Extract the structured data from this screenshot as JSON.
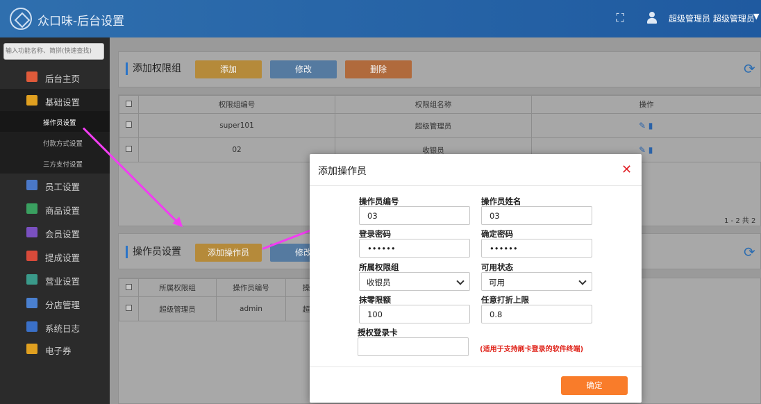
{
  "app": {
    "title": "众口味-后台设置",
    "username": "超级管理员 超级管理员"
  },
  "sidebar": {
    "search_placeholder": "输入功能名称、简拼(快速查找)",
    "items": [
      {
        "label": "后台主页",
        "color": "#e05a3a"
      },
      {
        "label": "基础设置",
        "color": "#e0a020"
      },
      {
        "label": "员工设置",
        "color": "#4a78c8"
      },
      {
        "label": "商品设置",
        "color": "#3aa060"
      },
      {
        "label": "会员设置",
        "color": "#7a50c0"
      },
      {
        "label": "提成设置",
        "color": "#d84a3a"
      },
      {
        "label": "营业设置",
        "color": "#3a9a8a"
      },
      {
        "label": "分店管理",
        "color": "#4a80d0"
      },
      {
        "label": "系统日志",
        "color": "#3a70c8"
      },
      {
        "label": "电子券",
        "color": "#e0a020"
      }
    ],
    "subitems": [
      "操作员设置",
      "付款方式设置",
      "三方支付设置"
    ]
  },
  "group_panel": {
    "title": "添加权限组",
    "buttons": [
      "添加",
      "修改",
      "删除"
    ],
    "columns": [
      "权限组编号",
      "权限组名称",
      "操作"
    ],
    "rows": [
      [
        "super101",
        "超级管理员"
      ],
      [
        "02",
        "收银员"
      ]
    ],
    "pager": "1 - 2   共 2"
  },
  "operator_panel": {
    "title": "操作员设置",
    "buttons": [
      "添加操作员",
      "修改"
    ],
    "columns": [
      "所属权限组",
      "操作员编号",
      "操"
    ],
    "rows": [
      [
        "超级管理员",
        "admin",
        "超"
      ]
    ]
  },
  "modal": {
    "title": "添加操作员",
    "fields": {
      "op_no": {
        "label": "操作员编号",
        "value": "03"
      },
      "op_name": {
        "label": "操作员姓名",
        "value": "03"
      },
      "pwd": {
        "label": "登录密码",
        "value": "••••••"
      },
      "pwd2": {
        "label": "确定密码",
        "value": "••••••"
      },
      "group": {
        "label": "所属权限组",
        "value": "收银员"
      },
      "status": {
        "label": "可用状态",
        "value": "可用"
      },
      "zero": {
        "label": "抹零限额",
        "value": "100"
      },
      "discount": {
        "label": "任意打折上限",
        "value": "0.8"
      },
      "card": {
        "label": "授权登录卡",
        "value": ""
      }
    },
    "card_note": "(适用于支持刷卡登录的软件终端)",
    "confirm": "确定"
  }
}
